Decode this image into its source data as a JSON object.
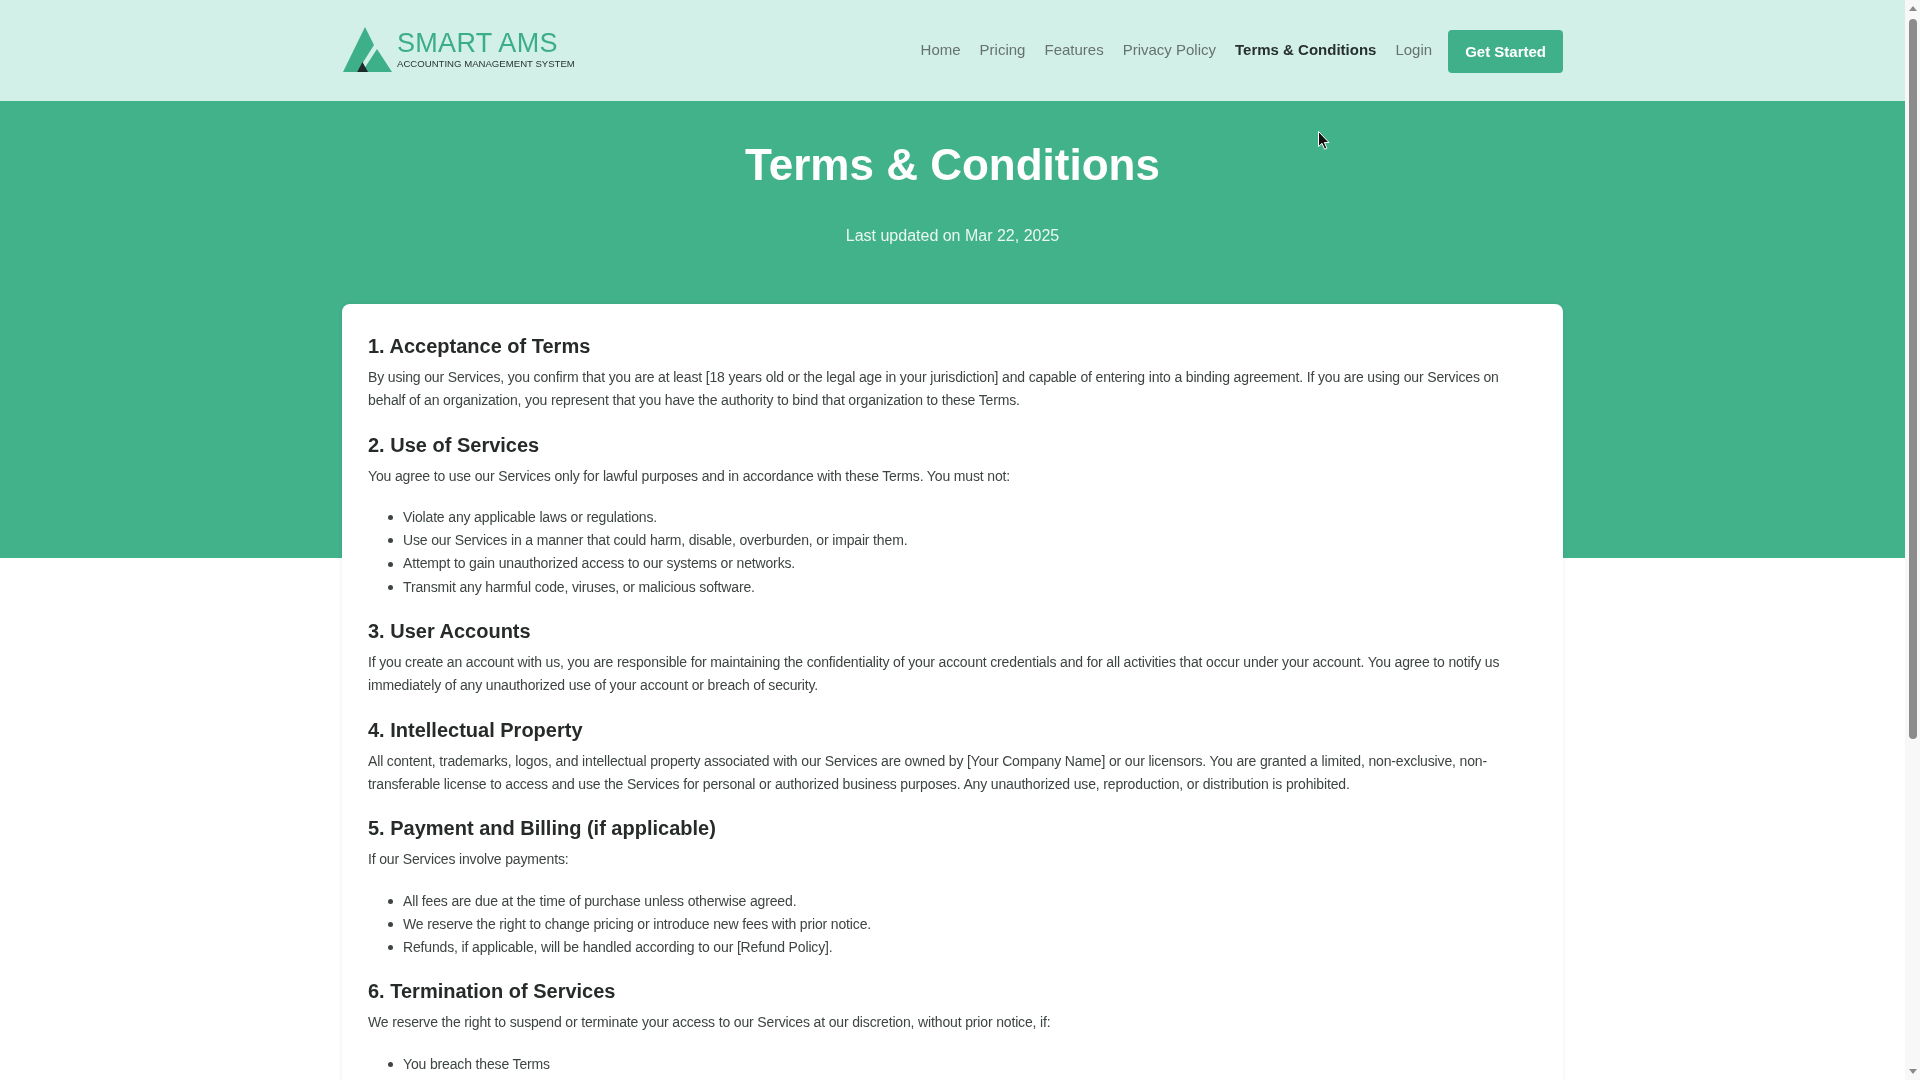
{
  "header": {
    "logo": {
      "title": "SMART AMS",
      "subtitle": "ACCOUNTING MANAGEMENT SYSTEM"
    },
    "nav": [
      {
        "label": "Home",
        "selected": false
      },
      {
        "label": "Pricing",
        "selected": false
      },
      {
        "label": "Features",
        "selected": false
      },
      {
        "label": "Privacy Policy",
        "selected": false
      },
      {
        "label": "Terms & Conditions",
        "selected": true
      },
      {
        "label": "Login",
        "selected": false
      }
    ],
    "button": "Get Started"
  },
  "hero": {
    "title": "Terms & Conditions",
    "subtitle": "Last updated on Mar 22, 2025"
  },
  "sections": [
    {
      "heading": "1. Acceptance of Terms",
      "paragraph": "By using our Services, you confirm that you are at least [18 years old or the legal age in your jurisdiction] and capable of entering into a binding agreement. If you are using our Services on behalf of an organization, you represent that you have the authority to bind that organization to these Terms."
    },
    {
      "heading": "2. Use of Services",
      "paragraph": "You agree to use our Services only for lawful purposes and in accordance with these Terms. You must not:",
      "items": [
        "Violate any applicable laws or regulations.",
        "Use our Services in a manner that could harm, disable, overburden, or impair them.",
        "Attempt to gain unauthorized access to our systems or networks.",
        "Transmit any harmful code, viruses, or malicious software."
      ]
    },
    {
      "heading": "3. User Accounts",
      "paragraph": "If you create an account with us, you are responsible for maintaining the confidentiality of your account credentials and for all activities that occur under your account. You agree to notify us immediately of any unauthorized use of your account or breach of security."
    },
    {
      "heading": "4. Intellectual Property",
      "paragraph": "All content, trademarks, logos, and intellectual property associated with our Services are owned by [Your Company Name] or our licensors. You are granted a limited, non-exclusive, non-transferable license to access and use the Services for personal or authorized business purposes. Any unauthorized use, reproduction, or distribution is prohibited."
    },
    {
      "heading": "5. Payment and Billing (if applicable)",
      "paragraph": "If our Services involve payments:",
      "items": [
        "All fees are due at the time of purchase unless otherwise agreed.",
        "We reserve the right to change pricing or introduce new fees with prior notice.",
        "Refunds, if applicable, will be handled according to our [Refund Policy]."
      ]
    },
    {
      "heading": "6. Termination of Services",
      "paragraph": "We reserve the right to suspend or terminate your access to our Services at our discretion, without prior notice, if:",
      "items": [
        "You breach these Terms"
      ]
    }
  ]
}
